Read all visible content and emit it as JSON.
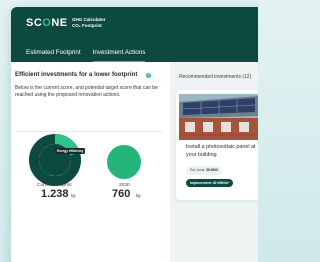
{
  "header": {
    "logo_prefix": "SC",
    "logo_o": "O",
    "logo_suffix": "NE",
    "tagline_line1": "GHG Calculator",
    "tagline_line2": "CO₂ Footprint",
    "tabs": [
      {
        "label": "Estimated Footprint",
        "active": false
      },
      {
        "label": "Investment Actions",
        "active": true
      }
    ]
  },
  "main": {
    "title": "Efficient investments for a lower footprint",
    "info_icon": "i",
    "description": "Below is the current score, and potential target score that can be reached using the proposed renovation actions.",
    "current": {
      "label": "Current footprint",
      "value": "1.238",
      "unit": "kg"
    },
    "target": {
      "label": "2030",
      "value": "760",
      "unit": "kg"
    },
    "donut_bubble": "Energy efficiency"
  },
  "recommendations": {
    "title": "Recommended investments (12)",
    "card": {
      "text": "Install a photovoltaic panel at your building",
      "cost_label": "Est. costs",
      "cost_value": "35.000€",
      "improvement": "Improvement: 30 kWh/m²"
    }
  },
  "colors": {
    "brand_dark": "#0c4a40",
    "brand_green": "#2ec38a",
    "target_green": "#25b57a"
  }
}
